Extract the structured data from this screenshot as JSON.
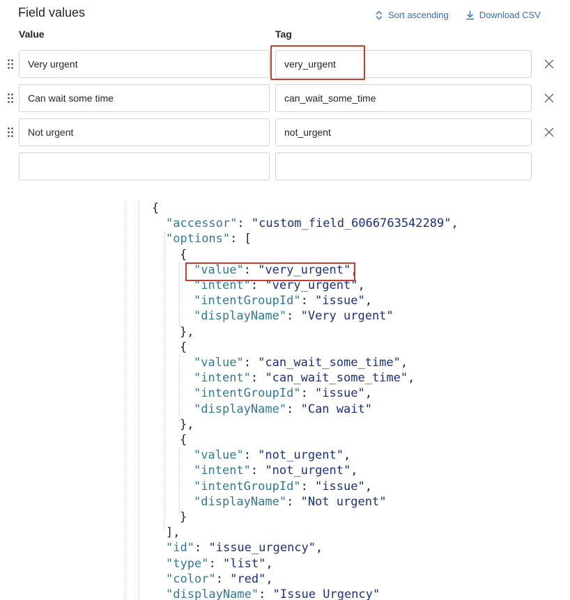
{
  "panel": {
    "title": "Field values",
    "sort_label": "Sort ascending",
    "download_label": "Download CSV",
    "columns": {
      "value": "Value",
      "tag": "Tag"
    },
    "rows": [
      {
        "value": "Very urgent",
        "tag": "very_urgent"
      },
      {
        "value": "Can wait some time",
        "tag": "can_wait_some_time"
      },
      {
        "value": "Not urgent",
        "tag": "not_urgent"
      },
      {
        "value": "",
        "tag": ""
      }
    ]
  },
  "code": {
    "lines": [
      {
        "indent": 0,
        "text": "{"
      },
      {
        "indent": 1,
        "key": "accessor",
        "value": "custom_field_6066763542289",
        "suffix": ","
      },
      {
        "indent": 1,
        "key": "options",
        "suffix": ": ["
      },
      {
        "indent": 2,
        "text": "{"
      },
      {
        "indent": 3,
        "key": "value",
        "value": "very_urgent",
        "suffix": ","
      },
      {
        "indent": 3,
        "key": "intent",
        "value": "very_urgent",
        "suffix": ","
      },
      {
        "indent": 3,
        "key": "intentGroupId",
        "value": "issue",
        "suffix": ","
      },
      {
        "indent": 3,
        "key": "displayName",
        "value": "Very urgent",
        "suffix": ""
      },
      {
        "indent": 2,
        "text": "},"
      },
      {
        "indent": 2,
        "text": "{"
      },
      {
        "indent": 3,
        "key": "value",
        "value": "can_wait_some_time",
        "suffix": ","
      },
      {
        "indent": 3,
        "key": "intent",
        "value": "can_wait_some_time",
        "suffix": ","
      },
      {
        "indent": 3,
        "key": "intentGroupId",
        "value": "issue",
        "suffix": ","
      },
      {
        "indent": 3,
        "key": "displayName",
        "value": "Can wait",
        "suffix": ""
      },
      {
        "indent": 2,
        "text": "},"
      },
      {
        "indent": 2,
        "text": "{"
      },
      {
        "indent": 3,
        "key": "value",
        "value": "not_urgent",
        "suffix": ","
      },
      {
        "indent": 3,
        "key": "intent",
        "value": "not_urgent",
        "suffix": ","
      },
      {
        "indent": 3,
        "key": "intentGroupId",
        "value": "issue",
        "suffix": ","
      },
      {
        "indent": 3,
        "key": "displayName",
        "value": "Not urgent",
        "suffix": ""
      },
      {
        "indent": 2,
        "text": "}"
      },
      {
        "indent": 1,
        "text": "],"
      },
      {
        "indent": 1,
        "key": "id",
        "value": "issue_urgency",
        "suffix": ","
      },
      {
        "indent": 1,
        "key": "type",
        "value": "list",
        "suffix": ","
      },
      {
        "indent": 1,
        "key": "color",
        "value": "red",
        "suffix": ","
      },
      {
        "indent": 1,
        "key": "displayName",
        "value": "Issue Urgency",
        "suffix": ""
      }
    ]
  },
  "colors": {
    "accent": "#2f6fbf",
    "highlight": "#c83a2e",
    "json_key": "#2e7a99",
    "json_string": "#1a2f86"
  },
  "icons": {
    "sort": "sort-updown-icon",
    "download": "download-icon",
    "drag": "drag-handle-icon",
    "remove": "close-icon"
  }
}
